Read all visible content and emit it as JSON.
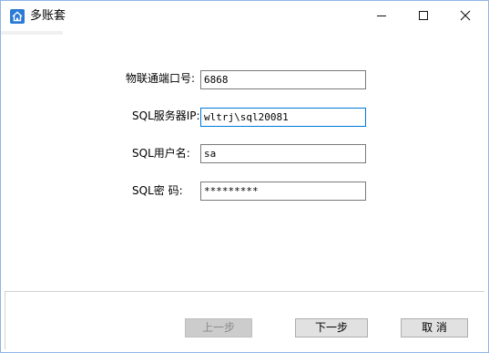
{
  "window": {
    "title": "多账套",
    "icon": "home-icon",
    "controls": [
      "minimize-icon",
      "maximize-icon",
      "close-icon"
    ]
  },
  "form": {
    "port": {
      "label": "物联通端口号:",
      "value": "6868"
    },
    "sql_server": {
      "label": "SQL服务器IP:",
      "value": "wltrj\\sql20081"
    },
    "sql_user": {
      "label": "SQL用户名:",
      "value": "sa"
    },
    "sql_password": {
      "label": "SQL密 码:",
      "value": "*********"
    }
  },
  "buttons": {
    "prev": "上一步",
    "next": "下一步",
    "cancel": "取 消"
  },
  "colors": {
    "accent": "#0078d7",
    "window_border": "#8fb5e6",
    "button_face": "#e1e1e1"
  }
}
